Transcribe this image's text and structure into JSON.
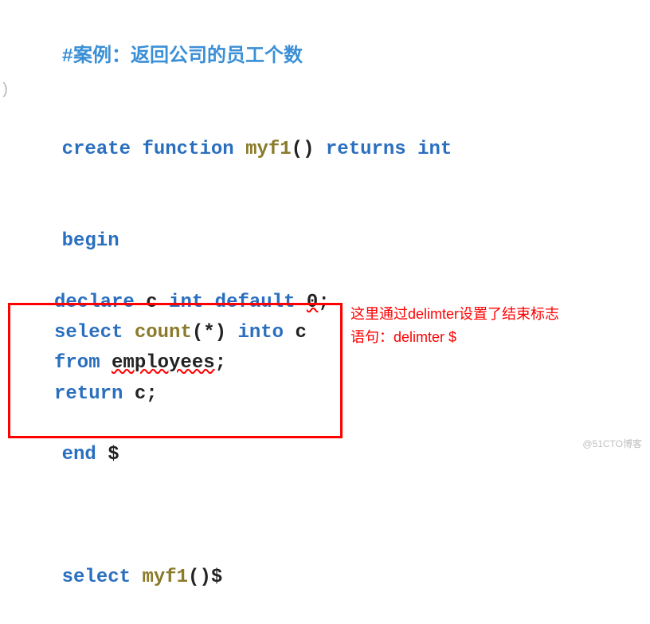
{
  "code": {
    "comment": "#案例：返回公司的员工个数",
    "l2": {
      "create": "create",
      "function": "function",
      "name": "myf1",
      "paren": "()",
      "returns": "returns",
      "type": "int"
    },
    "l3": {
      "begin": "begin"
    },
    "l4": {
      "declare": "declare",
      "var": "c",
      "type": "int",
      "default": "default",
      "zero": "0",
      "semi": ";"
    },
    "l5": {
      "select": "select",
      "count": "count",
      "star": "(*)",
      "into": "into",
      "var": "c"
    },
    "l6": {
      "from": "from",
      "table": "employees",
      "semi": ";"
    },
    "l7": {
      "return": "return",
      "var": "c",
      "semi": ";"
    },
    "l8": {
      "end": "end",
      "dollar": "$"
    },
    "l9": {
      "select": "select",
      "name": "myf1",
      "tail": "()$"
    }
  },
  "annotation": {
    "line1": "这里通过delimter设置了结束标志",
    "line2": "语句：delimter $"
  },
  "watermark": "@51CTO博客"
}
